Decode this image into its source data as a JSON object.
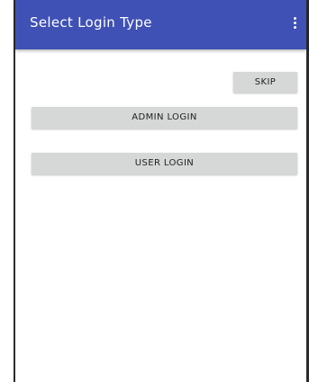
{
  "appbar": {
    "title": "Select Login Type",
    "background_color": "#3f51b5",
    "overflow_icon": "more-vertical-icon"
  },
  "actions": {
    "skip_label": "SKIP",
    "admin_login_label": "ADMIN LOGIN",
    "user_login_label": "USER LOGIN",
    "button_color": "#d6d7d7"
  }
}
